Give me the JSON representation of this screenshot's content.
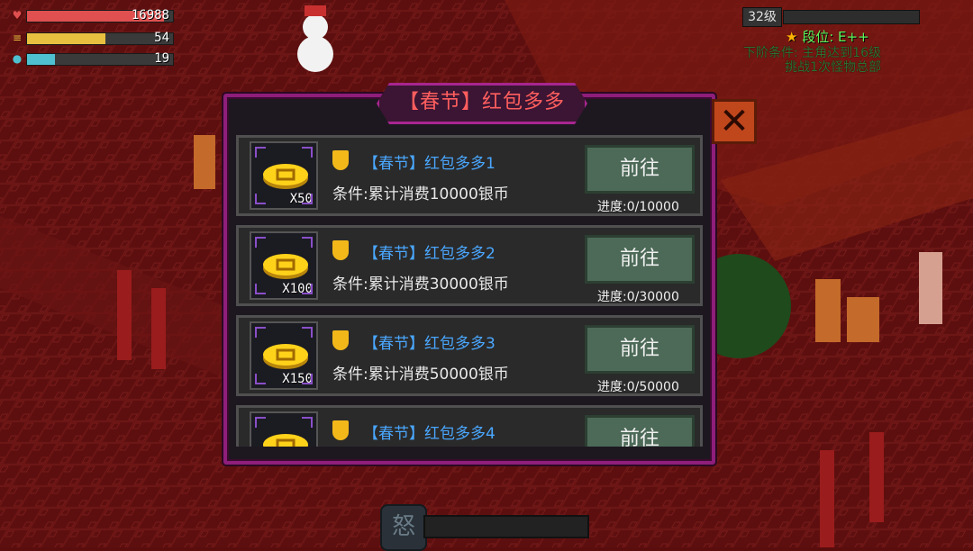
{
  "hud": {
    "hp": {
      "icon": "heart-icon",
      "value": "16988",
      "fill": 0.94,
      "color": "#e05050"
    },
    "food": {
      "icon": "burger-icon",
      "value": "54",
      "fill": 0.54,
      "color": "#e8c040"
    },
    "water": {
      "icon": "water-drop-icon",
      "value": "19",
      "fill": 0.19,
      "color": "#4ec0d0"
    },
    "level": "32级",
    "xp_fill": 0.0,
    "rank_star_icon": "star-icon",
    "rank": "段位: E++",
    "next_cond_line1": "下阶条件: 主角达到16级",
    "next_cond_line2": "挑战1次怪物总部"
  },
  "modal": {
    "title": "【春节】红包多多",
    "close_icon": "close-icon",
    "items": [
      {
        "coin_icon": "gold-coin-icon",
        "qty": "X50",
        "title": "【春节】红包多多1",
        "condition": "条件:累计消费10000银币",
        "button": "前往",
        "progress": "进度:0/10000"
      },
      {
        "coin_icon": "gold-coin-icon",
        "qty": "X100",
        "title": "【春节】红包多多2",
        "condition": "条件:累计消费30000银币",
        "button": "前往",
        "progress": "进度:0/30000"
      },
      {
        "coin_icon": "gold-coin-icon",
        "qty": "X150",
        "title": "【春节】红包多多3",
        "condition": "条件:累计消费50000银币",
        "button": "前往",
        "progress": "进度:0/50000"
      },
      {
        "coin_icon": "gold-coin-icon",
        "qty": "",
        "title": "【春节】红包多多4",
        "condition": "",
        "button": "前往",
        "progress": ""
      }
    ]
  },
  "bottom": {
    "rage_glyph": "怒",
    "rage_icon": "rage-icon"
  },
  "colors": {
    "modal_border": "#8e1e7a",
    "title_red": "#ff5e5e",
    "item_title_blue": "#4aa7ff",
    "rank_green": "#5df45d",
    "go_button": "#4c6a57"
  }
}
